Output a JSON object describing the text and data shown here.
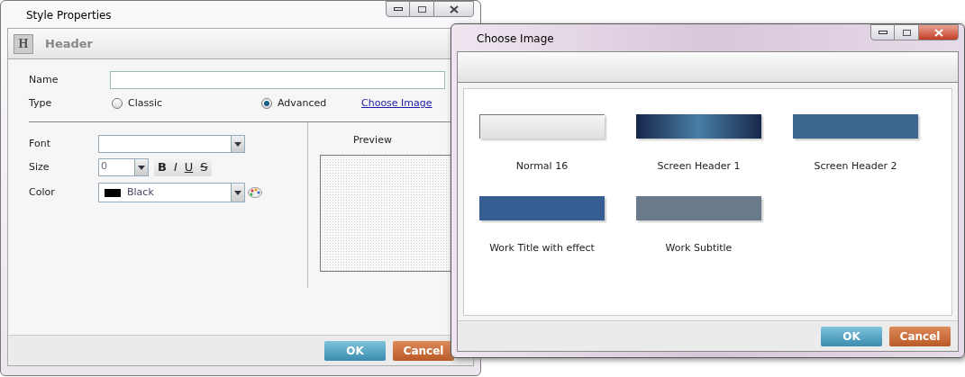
{
  "style_window": {
    "title": "Style Properties",
    "header_badge": "H",
    "header": "Header",
    "name_field": {
      "label": "Name"
    },
    "type": {
      "label": "Type",
      "options": [
        {
          "label": "Classic",
          "selected": false
        },
        {
          "label": "Advanced",
          "selected": true
        }
      ],
      "link": "Choose Image"
    },
    "font": {
      "label": "Font"
    },
    "size": {
      "label": "Size",
      "value": "0",
      "format_buttons": [
        {
          "kind": "bold",
          "label": "B"
        },
        {
          "kind": "italic",
          "label": "I"
        },
        {
          "kind": "underline",
          "label": "U"
        },
        {
          "kind": "strike",
          "label": "S"
        }
      ]
    },
    "color": {
      "label": "Color",
      "value": "Black"
    },
    "preview_label": "Preview",
    "buttons": [
      {
        "kind": "ok",
        "label": "OK"
      },
      {
        "kind": "cancel",
        "label": "Cancel"
      }
    ]
  },
  "choose_window": {
    "title": "Choose Image",
    "images": [
      {
        "name": "Normal 16",
        "kind": "light",
        "color": "#e0e0e0"
      },
      {
        "name": "Screen Header 1",
        "kind": "glow",
        "color": "#16284a"
      },
      {
        "name": "Screen Header 2",
        "kind": "flat",
        "color": "#3d6690"
      },
      {
        "name": "Work Title with effect",
        "kind": "flat",
        "color": "#365e92"
      },
      {
        "name": "Work Subtitle",
        "kind": "flat",
        "color": "#6b7a8a"
      }
    ],
    "buttons": [
      {
        "kind": "ok",
        "label": "OK"
      },
      {
        "kind": "cancel",
        "label": "Cancel"
      }
    ]
  }
}
